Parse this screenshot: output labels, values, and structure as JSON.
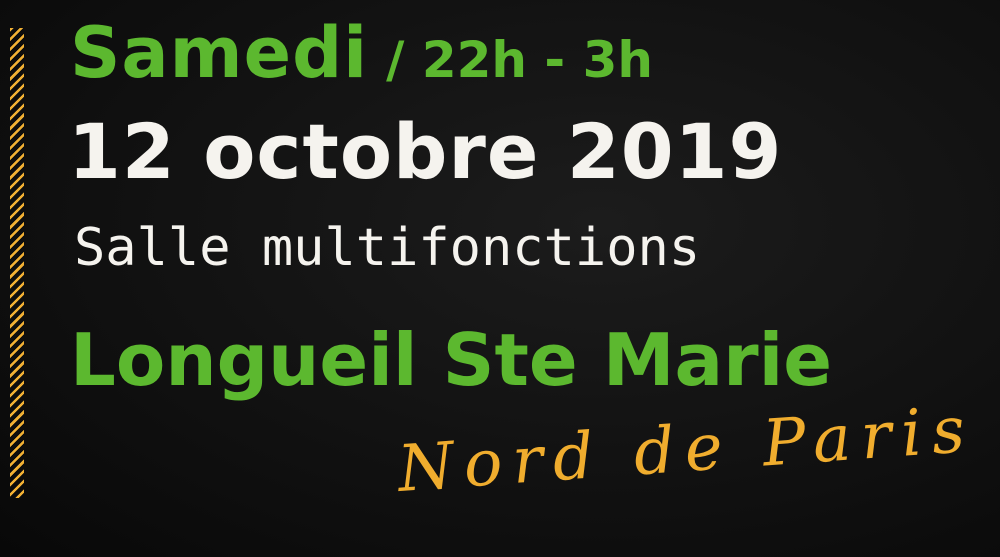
{
  "event": {
    "day": "Samedi",
    "hours": "/ 22h - 3h",
    "date": "12 octobre 2019",
    "venue": "Salle multifonctions",
    "city": "Longueil Ste Marie",
    "region": "Nord de Paris"
  },
  "colors": {
    "green": "#5cb82f",
    "white": "#f5f3ee",
    "gold": "#f0ad2e",
    "stripe": "#f2b134",
    "background": "#111111"
  }
}
